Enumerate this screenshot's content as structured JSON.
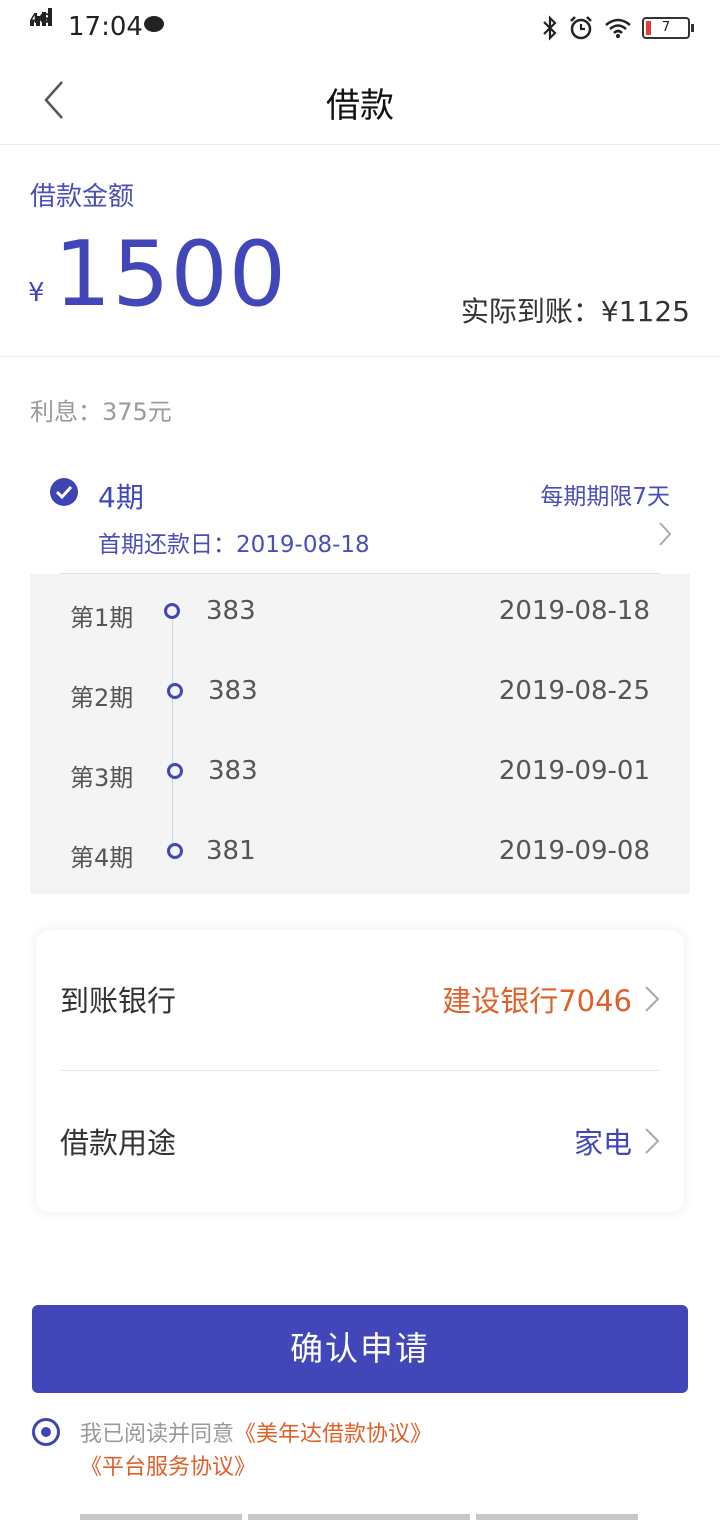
{
  "status_bar": {
    "network": "4G",
    "time": "17:04",
    "battery": "7"
  },
  "header": {
    "title": "借款"
  },
  "loan": {
    "amount_label": "借款金额",
    "currency": "¥",
    "amount": "1500",
    "actual_received": "实际到账：¥1125",
    "interest": "利息：375元"
  },
  "plan": {
    "periods": "4期",
    "first_due": "首期还款日：2019-08-18",
    "limit": "每期期限7天",
    "schedule": [
      {
        "label": "第1期",
        "amount": "383",
        "date": "2019-08-18"
      },
      {
        "label": "第2期",
        "amount": "383",
        "date": "2019-08-25"
      },
      {
        "label": "第3期",
        "amount": "383",
        "date": "2019-09-01"
      },
      {
        "label": "第4期",
        "amount": "381",
        "date": "2019-09-08"
      }
    ]
  },
  "details": {
    "bank_label": "到账银行",
    "bank_value": "建设银行7046",
    "purpose_label": "借款用途",
    "purpose_value": "家电"
  },
  "submit_label": "确认申请",
  "agreement": {
    "prefix": "我已阅读并同意",
    "link1": "《美年达借款协议》",
    "link2": "《平台服务协议》"
  },
  "colors": {
    "primary": "#4147b8",
    "accent": "#e0602a"
  }
}
